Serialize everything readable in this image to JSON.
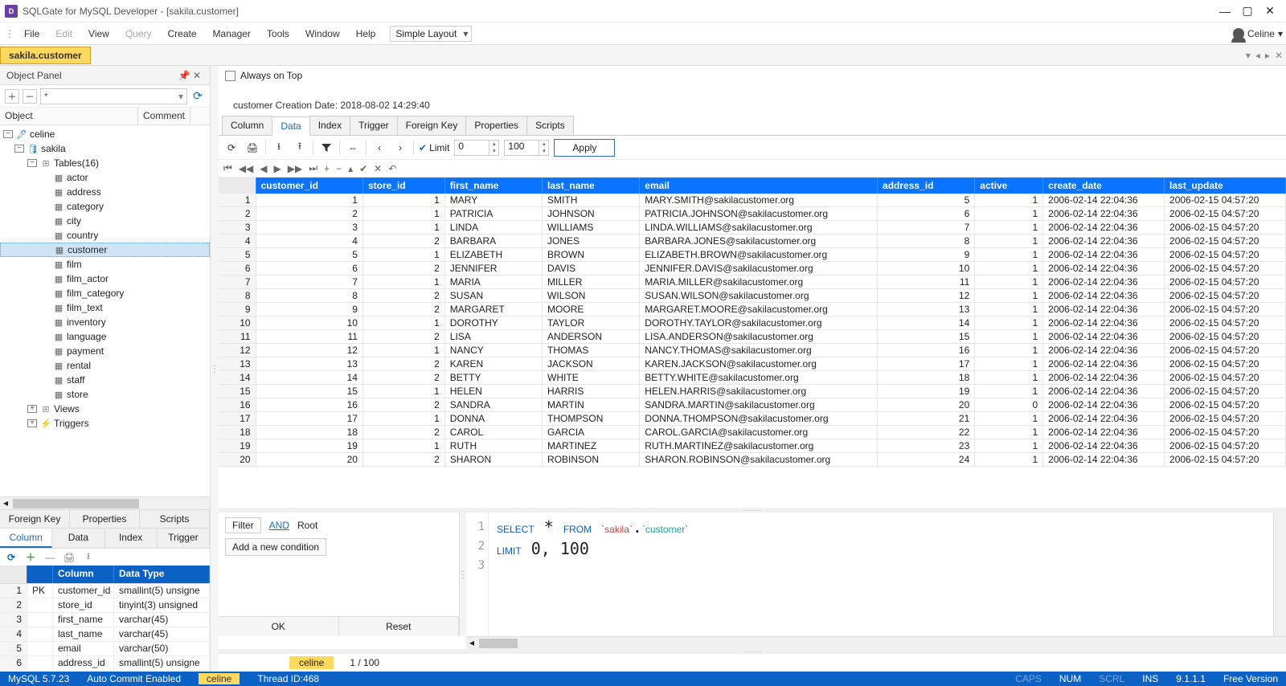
{
  "titlebar": {
    "app_icon_letter": "D",
    "title": "SQLGate for MySQL Developer - [sakila.customer]"
  },
  "menubar": {
    "items": [
      "File",
      "Edit",
      "View",
      "Query",
      "Create",
      "Manager",
      "Tools",
      "Window",
      "Help"
    ],
    "layout": "Simple Layout",
    "user": "Celine"
  },
  "active_tab": "sakila.customer",
  "object_panel": {
    "title": "Object Panel",
    "search_value": "*",
    "headers": [
      "Object",
      "Comment"
    ],
    "tree": {
      "root": "celine",
      "schema": "sakila",
      "tables_label": "Tables(16)",
      "tables": [
        "actor",
        "address",
        "category",
        "city",
        "country",
        "customer",
        "film",
        "film_actor",
        "film_category",
        "film_text",
        "inventory",
        "language",
        "payment",
        "rental",
        "staff",
        "store"
      ],
      "selected_table": "customer",
      "views_label": "Views",
      "triggers_label": "Triggers"
    },
    "bottom_tabs_row1": [
      "Foreign Key",
      "Properties",
      "Scripts"
    ],
    "bottom_tabs_row2": [
      "Column",
      "Data",
      "Index",
      "Trigger"
    ],
    "active_bottom_tab": "Column",
    "column_grid": {
      "headers": [
        "",
        "",
        "Column",
        "Data Type"
      ],
      "rows": [
        {
          "n": 1,
          "pk": "PK",
          "col": "customer_id",
          "type": "smallint(5) unsigne"
        },
        {
          "n": 2,
          "pk": "",
          "col": "store_id",
          "type": "tinyint(3) unsigned"
        },
        {
          "n": 3,
          "pk": "",
          "col": "first_name",
          "type": "varchar(45)"
        },
        {
          "n": 4,
          "pk": "",
          "col": "last_name",
          "type": "varchar(45)"
        },
        {
          "n": 5,
          "pk": "",
          "col": "email",
          "type": "varchar(50)"
        },
        {
          "n": 6,
          "pk": "",
          "col": "address_id",
          "type": "smallint(5) unsigne"
        }
      ]
    }
  },
  "right": {
    "always_on_top": "Always on Top",
    "creation": "customer Creation Date: 2018-08-02 14:29:40",
    "data_tabs": [
      "Column",
      "Data",
      "Index",
      "Trigger",
      "Foreign Key",
      "Properties",
      "Scripts"
    ],
    "active_data_tab": "Data",
    "toolbar": {
      "limit_label": "Limit",
      "limit_from": "0",
      "limit_to": "100",
      "apply": "Apply"
    },
    "grid": {
      "columns": [
        "customer_id",
        "store_id",
        "first_name",
        "last_name",
        "email",
        "address_id",
        "active",
        "create_date",
        "last_update"
      ],
      "rows": [
        [
          1,
          1,
          1,
          "MARY",
          "SMITH",
          "MARY.SMITH@sakilacustomer.org",
          5,
          1,
          "2006-02-14 22:04:36",
          "2006-02-15 04:57:20"
        ],
        [
          2,
          2,
          1,
          "PATRICIA",
          "JOHNSON",
          "PATRICIA.JOHNSON@sakilacustomer.org",
          6,
          1,
          "2006-02-14 22:04:36",
          "2006-02-15 04:57:20"
        ],
        [
          3,
          3,
          1,
          "LINDA",
          "WILLIAMS",
          "LINDA.WILLIAMS@sakilacustomer.org",
          7,
          1,
          "2006-02-14 22:04:36",
          "2006-02-15 04:57:20"
        ],
        [
          4,
          4,
          2,
          "BARBARA",
          "JONES",
          "BARBARA.JONES@sakilacustomer.org",
          8,
          1,
          "2006-02-14 22:04:36",
          "2006-02-15 04:57:20"
        ],
        [
          5,
          5,
          1,
          "ELIZABETH",
          "BROWN",
          "ELIZABETH.BROWN@sakilacustomer.org",
          9,
          1,
          "2006-02-14 22:04:36",
          "2006-02-15 04:57:20"
        ],
        [
          6,
          6,
          2,
          "JENNIFER",
          "DAVIS",
          "JENNIFER.DAVIS@sakilacustomer.org",
          10,
          1,
          "2006-02-14 22:04:36",
          "2006-02-15 04:57:20"
        ],
        [
          7,
          7,
          1,
          "MARIA",
          "MILLER",
          "MARIA.MILLER@sakilacustomer.org",
          11,
          1,
          "2006-02-14 22:04:36",
          "2006-02-15 04:57:20"
        ],
        [
          8,
          8,
          2,
          "SUSAN",
          "WILSON",
          "SUSAN.WILSON@sakilacustomer.org",
          12,
          1,
          "2006-02-14 22:04:36",
          "2006-02-15 04:57:20"
        ],
        [
          9,
          9,
          2,
          "MARGARET",
          "MOORE",
          "MARGARET.MOORE@sakilacustomer.org",
          13,
          1,
          "2006-02-14 22:04:36",
          "2006-02-15 04:57:20"
        ],
        [
          10,
          10,
          1,
          "DOROTHY",
          "TAYLOR",
          "DOROTHY.TAYLOR@sakilacustomer.org",
          14,
          1,
          "2006-02-14 22:04:36",
          "2006-02-15 04:57:20"
        ],
        [
          11,
          11,
          2,
          "LISA",
          "ANDERSON",
          "LISA.ANDERSON@sakilacustomer.org",
          15,
          1,
          "2006-02-14 22:04:36",
          "2006-02-15 04:57:20"
        ],
        [
          12,
          12,
          1,
          "NANCY",
          "THOMAS",
          "NANCY.THOMAS@sakilacustomer.org",
          16,
          1,
          "2006-02-14 22:04:36",
          "2006-02-15 04:57:20"
        ],
        [
          13,
          13,
          2,
          "KAREN",
          "JACKSON",
          "KAREN.JACKSON@sakilacustomer.org",
          17,
          1,
          "2006-02-14 22:04:36",
          "2006-02-15 04:57:20"
        ],
        [
          14,
          14,
          2,
          "BETTY",
          "WHITE",
          "BETTY.WHITE@sakilacustomer.org",
          18,
          1,
          "2006-02-14 22:04:36",
          "2006-02-15 04:57:20"
        ],
        [
          15,
          15,
          1,
          "HELEN",
          "HARRIS",
          "HELEN.HARRIS@sakilacustomer.org",
          19,
          1,
          "2006-02-14 22:04:36",
          "2006-02-15 04:57:20"
        ],
        [
          16,
          16,
          2,
          "SANDRA",
          "MARTIN",
          "SANDRA.MARTIN@sakilacustomer.org",
          20,
          0,
          "2006-02-14 22:04:36",
          "2006-02-15 04:57:20"
        ],
        [
          17,
          17,
          1,
          "DONNA",
          "THOMPSON",
          "DONNA.THOMPSON@sakilacustomer.org",
          21,
          1,
          "2006-02-14 22:04:36",
          "2006-02-15 04:57:20"
        ],
        [
          18,
          18,
          2,
          "CAROL",
          "GARCIA",
          "CAROL.GARCIA@sakilacustomer.org",
          22,
          1,
          "2006-02-14 22:04:36",
          "2006-02-15 04:57:20"
        ],
        [
          19,
          19,
          1,
          "RUTH",
          "MARTINEZ",
          "RUTH.MARTINEZ@sakilacustomer.org",
          23,
          1,
          "2006-02-14 22:04:36",
          "2006-02-15 04:57:20"
        ],
        [
          20,
          20,
          2,
          "SHARON",
          "ROBINSON",
          "SHARON.ROBINSON@sakilacustomer.org",
          24,
          1,
          "2006-02-14 22:04:36",
          "2006-02-15 04:57:20"
        ]
      ]
    },
    "filter": {
      "filter_label": "Filter",
      "and": "AND",
      "root": "Root",
      "add": "Add a new condition",
      "ok": "OK",
      "reset": "Reset"
    },
    "sql_lines": [
      "1",
      "2",
      "3"
    ],
    "sql_html": "<span class='kw'>SELECT</span> * <span class='kw'>FROM</span> <span class='str'>`sakila`</span>.<span class='id'>`customer`</span>\n<span class='kw'>LIMIT</span> 0, 100\n",
    "pager": {
      "db": "celine",
      "pos": "1 / 100"
    }
  },
  "statusbar": {
    "db": "MySQL 5.7.23",
    "autocommit": "Auto Commit Enabled",
    "user": "celine",
    "thread": "Thread ID:468",
    "caps": "CAPS",
    "num": "NUM",
    "scrl": "SCRL",
    "ins": "INS",
    "ver": "9.1.1.1",
    "free": "Free Version"
  }
}
